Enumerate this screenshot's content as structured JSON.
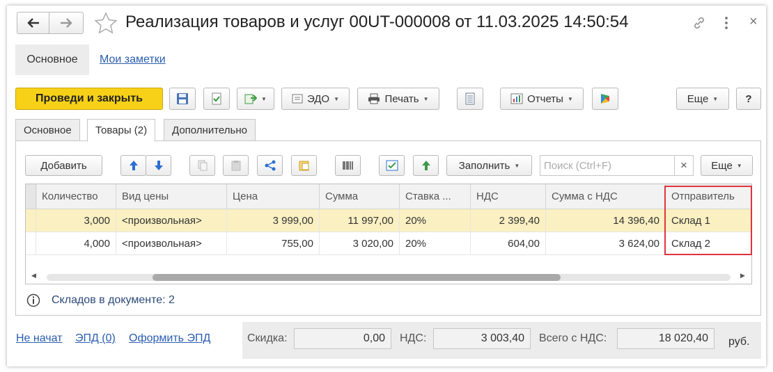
{
  "window": {
    "title": "Реализация товаров и услуг 00UT-000008 от 11.03.2025 14:50:54",
    "back_icon": "arrow-left",
    "forward_icon": "arrow-right",
    "favorite_icon": "star-outline",
    "link_icon": "chain-link",
    "more_icon": "vertical-dots",
    "close_icon": "×"
  },
  "nav": {
    "main_label": "Основное",
    "notes_label": "Мои заметки"
  },
  "toolbar": {
    "post_close_label": "Проведи и закрыть",
    "edo_label": "ЭДО",
    "print_label": "Печать",
    "reports_label": "Отчеты",
    "more_label": "Еще",
    "help_label": "?",
    "post_close_color": "#f7d117"
  },
  "tabs": [
    {
      "label": "Основное"
    },
    {
      "label": "Товары (2)"
    },
    {
      "label": "Дополнительно"
    }
  ],
  "table_toolbar": {
    "add_label": "Добавить",
    "fill_label": "Заполнить",
    "search_placeholder": "Поиск (Ctrl+F)",
    "search_clear": "×",
    "more_label": "Еще"
  },
  "table": {
    "columns": [
      "Количество",
      "Вид цены",
      "Цена",
      "Сумма",
      "Ставка ...",
      "НДС",
      "Сумма с НДС",
      "Отправитель"
    ],
    "rows": [
      [
        "3,000",
        "<произвольная>",
        "3 999,00",
        "11 997,00",
        "20%",
        "2 399,40",
        "14 396,40",
        "Склад 1"
      ],
      [
        "4,000",
        "<произвольная>",
        "755,00",
        "3 020,00",
        "20%",
        "604,00",
        "3 624,00",
        "Склад 2"
      ]
    ],
    "selected_row": 0,
    "highlight_color": "#e0333f"
  },
  "info": {
    "icon": "info-circle",
    "text": "Складов в документе: 2"
  },
  "footer": {
    "status_link": "Не начат",
    "epd_link": "ЭПД (0)",
    "create_epd_link": "Оформить ЭПД",
    "discount_label": "Скидка:",
    "discount_value": "0,00",
    "vat_label": "НДС:",
    "vat_value": "3 003,40",
    "total_label": "Всего с НДС:",
    "total_value": "18 020,40",
    "currency": "руб."
  }
}
